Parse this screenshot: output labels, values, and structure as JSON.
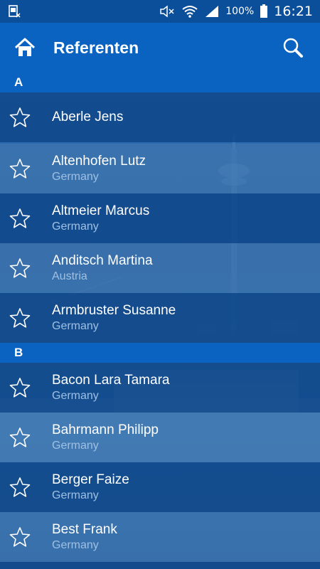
{
  "status_bar": {
    "battery_percent": "100%",
    "time": "16:21",
    "icons": [
      "sim-icon",
      "mute-icon",
      "wifi-icon",
      "signal-icon",
      "battery-icon"
    ]
  },
  "app_bar": {
    "title": "Referenten",
    "home_icon": "home-icon",
    "search_icon": "search-icon"
  },
  "sections": [
    {
      "letter": "A",
      "items": [
        {
          "name": "Aberle Jens",
          "country": ""
        },
        {
          "name": "Altenhofen Lutz",
          "country": "Germany"
        },
        {
          "name": "Altmeier Marcus",
          "country": "Germany"
        },
        {
          "name": "Anditsch Martina",
          "country": "Austria"
        },
        {
          "name": "Armbruster Susanne",
          "country": "Germany"
        }
      ]
    },
    {
      "letter": "B",
      "items": [
        {
          "name": "Bacon Lara Tamara",
          "country": "Germany"
        },
        {
          "name": "Bahrmann Philipp",
          "country": "Germany"
        },
        {
          "name": "Berger Faize",
          "country": "Germany"
        },
        {
          "name": "Best Frank",
          "country": "Germany"
        }
      ]
    }
  ],
  "colors": {
    "app_bar": "#0a63c0",
    "status_bar": "#0b4f9a",
    "secondary_text": "#9fc0e3"
  }
}
